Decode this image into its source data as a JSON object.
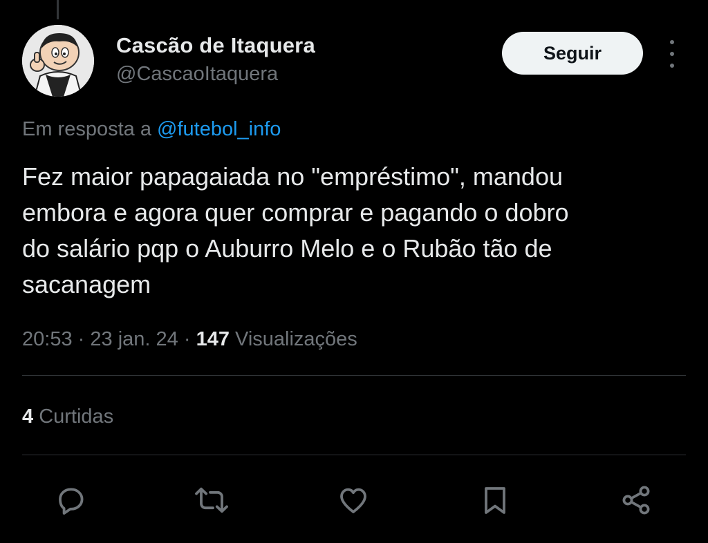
{
  "tweet": {
    "author": {
      "display_name": "Cascão de Itaquera",
      "handle": "@CascaoItaquera",
      "avatar_icon": "avatar-cartoon"
    },
    "follow_label": "Seguir",
    "more_icon": "more-vertical-icon",
    "reply_context": {
      "prefix": "Em resposta a ",
      "mention": "@futebol_info"
    },
    "text": "Fez maior papagaiada no \"empréstimo\", mandou\nembora e agora quer comprar e pagando o dobro\ndo salário pqp o Auburro Melo e o Rubão tão de\nsacanagem",
    "time": "20:53",
    "date": "23 jan. 24",
    "separator": "·",
    "views_count": "147",
    "views_label": "Visualizações",
    "likes_count": "4",
    "likes_label": "Curtidas",
    "actions": [
      {
        "name": "reply",
        "icon": "reply-icon"
      },
      {
        "name": "repost",
        "icon": "repost-icon"
      },
      {
        "name": "like",
        "icon": "heart-icon"
      },
      {
        "name": "bookmark",
        "icon": "bookmark-icon"
      },
      {
        "name": "share",
        "icon": "share-icon"
      }
    ]
  },
  "colors": {
    "background": "#000000",
    "text_primary": "#e7e9ea",
    "text_secondary": "#71767b",
    "link": "#1d9bf0",
    "divider": "#2f3336",
    "follow_button_bg": "#eff3f4"
  }
}
